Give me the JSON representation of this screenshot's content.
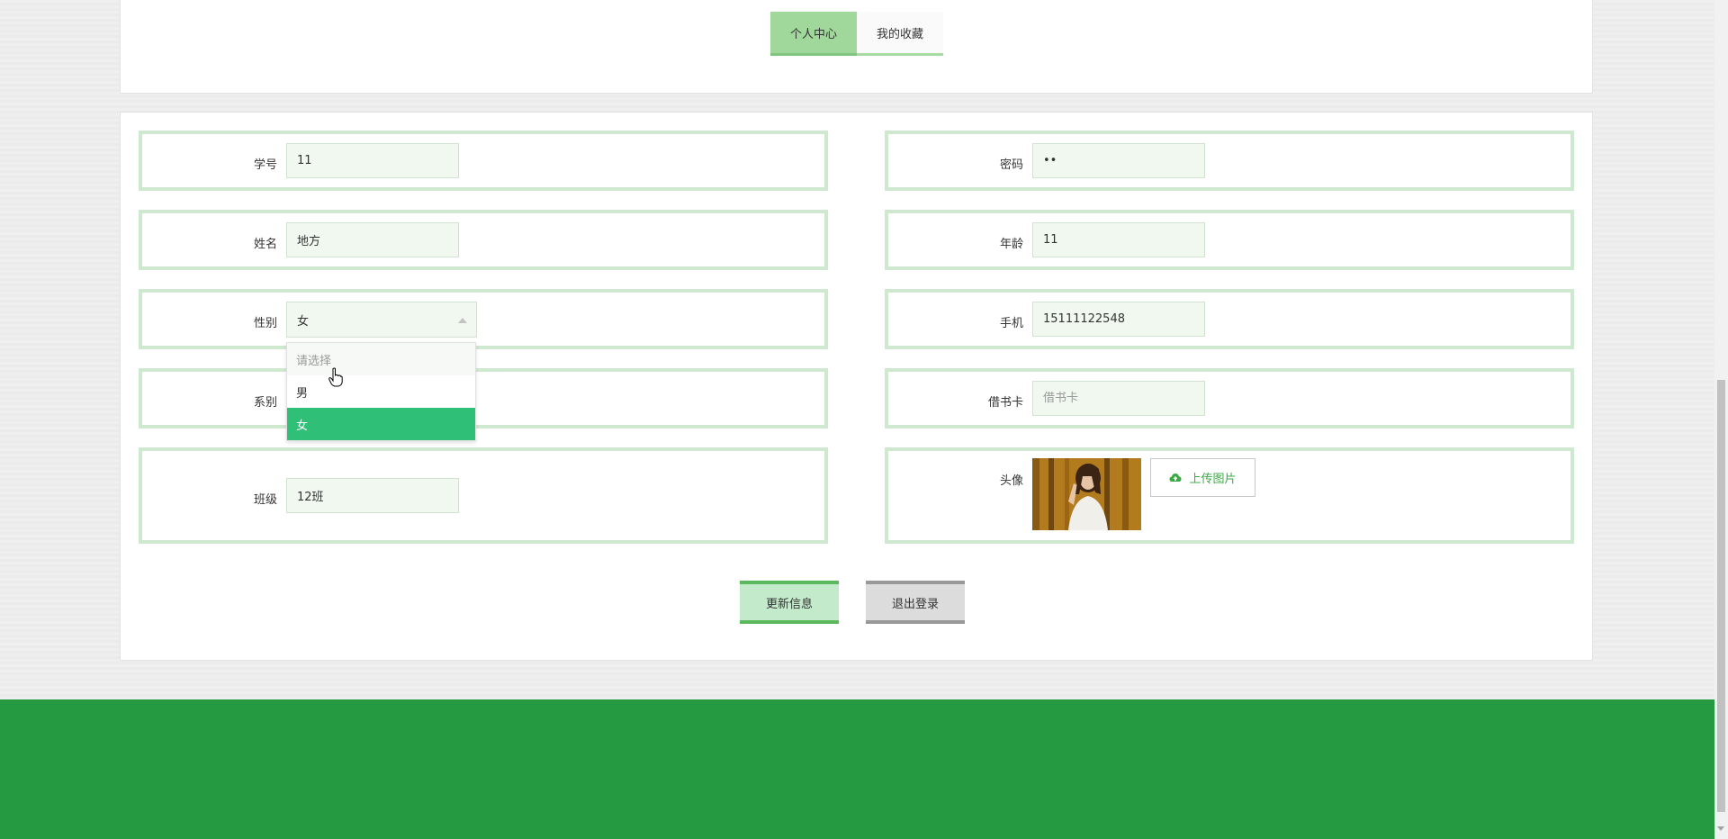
{
  "tabs": [
    {
      "label": "个人中心",
      "active": true
    },
    {
      "label": "我的收藏",
      "active": false
    }
  ],
  "form": {
    "student_id": {
      "label": "学号",
      "value": "11"
    },
    "password": {
      "label": "密码",
      "value": "••"
    },
    "name": {
      "label": "姓名",
      "value": "地方"
    },
    "age": {
      "label": "年龄",
      "value": "11"
    },
    "gender": {
      "label": "性别",
      "value": "女"
    },
    "phone": {
      "label": "手机",
      "value": "15111122548"
    },
    "department": {
      "label": "系别",
      "value": ""
    },
    "library_card": {
      "label": "借书卡",
      "value": "",
      "placeholder": "借书卡"
    },
    "class": {
      "label": "班级",
      "value": "12班"
    },
    "avatar": {
      "label": "头像",
      "upload_label": "上传图片"
    }
  },
  "gender_dropdown": {
    "options": [
      "请选择",
      "男",
      "女"
    ],
    "selected": "女"
  },
  "buttons": {
    "update": "更新信息",
    "logout": "退出登录"
  },
  "colors": {
    "accent": "#9fd89a",
    "selected_option": "#2fbf76",
    "footer": "#259a40",
    "field_border": "#cfe9d0"
  },
  "icons": {
    "upload": "cloud-upload-icon",
    "select_arrow": "caret-up-icon",
    "cursor": "hand-pointer-icon"
  }
}
